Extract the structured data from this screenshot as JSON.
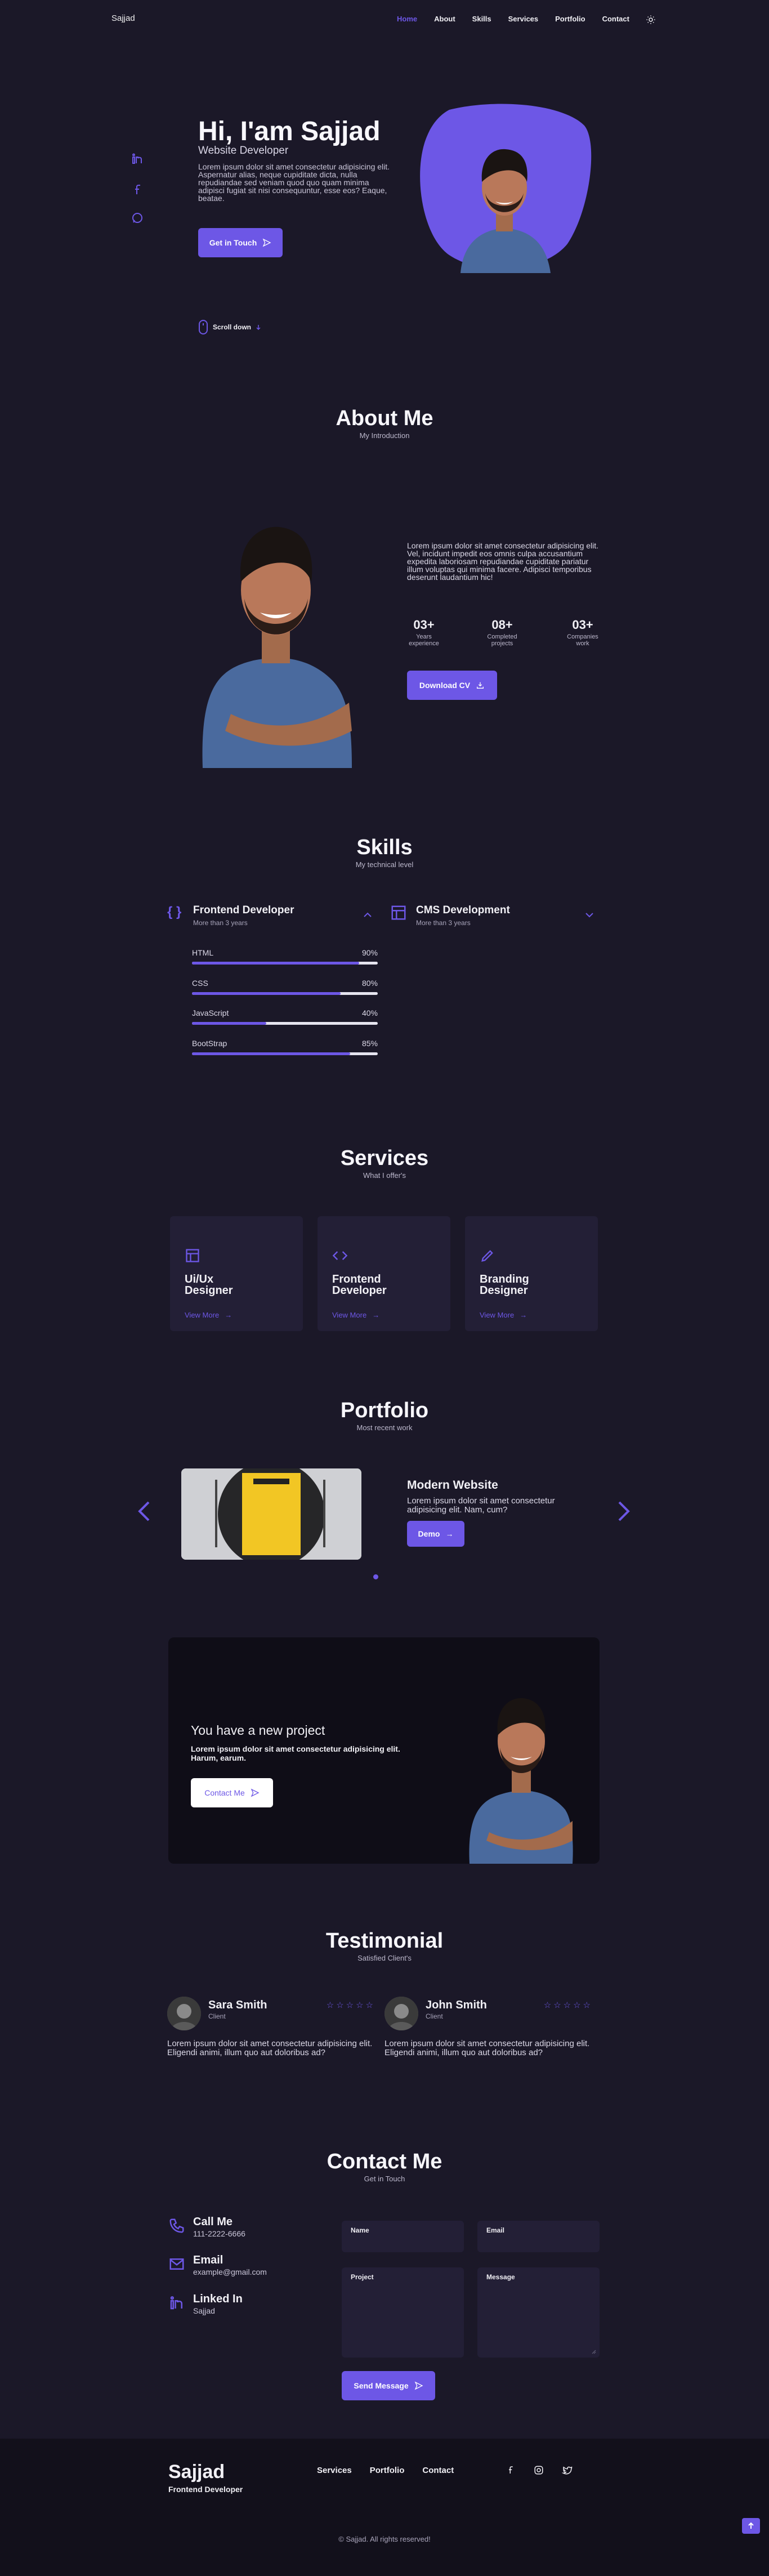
{
  "header": {
    "logo": "Sajjad",
    "nav": [
      "Home",
      "About",
      "Skills",
      "Services",
      "Portfolio",
      "Contact"
    ],
    "active_nav": "Home",
    "theme_icon": "sun-icon"
  },
  "social": [
    "linkedin-icon",
    "facebook-icon",
    "whatsapp-icon"
  ],
  "hero": {
    "title": "Hi, I'am Sajjad",
    "subtitle": "Website Developer",
    "description": "Lorem ipsum dolor sit amet consectetur adipisicing elit. Aspernatur alias, neque cupiditate dicta, nulla repudiandae sed veniam quod quo quam minima adipisci fugiat sit nisi consequuntur, esse eos? Eaque, beatae.",
    "button": "Get in Touch",
    "scroll": "Scroll down"
  },
  "about": {
    "title": "About Me",
    "subtitle": "My Introduction",
    "description": "Lorem ipsum dolor sit amet consectetur adipisicing elit. Vel, incidunt impedit eos omnis culpa accusantium expedita laboriosam repudiandae cupiditate pariatur illum voluptas qui minima facere. Adipisci temporibus deserunt laudantium hic!",
    "stats": [
      {
        "number": "03+",
        "label1": "Years",
        "label2": "experience"
      },
      {
        "number": "08+",
        "label1": "Completed",
        "label2": "projects"
      },
      {
        "number": "03+",
        "label1": "Companies",
        "label2": "work"
      }
    ],
    "button": "Download CV"
  },
  "skills": {
    "title": "Skills",
    "subtitle": "My technical level",
    "groups": [
      {
        "title": "Frontend Developer",
        "sub": "More than 3 years"
      },
      {
        "title": "CMS Development",
        "sub": "More than 3 years"
      }
    ],
    "bars": [
      {
        "name": "HTML",
        "pct": "90%",
        "value": 0.9
      },
      {
        "name": "CSS",
        "pct": "80%",
        "value": 0.8
      },
      {
        "name": "JavaScript",
        "pct": "40%",
        "value": 0.4
      },
      {
        "name": "BootStrap",
        "pct": "85%",
        "value": 0.85
      }
    ]
  },
  "services": {
    "title": "Services",
    "subtitle": "What I offer's",
    "cards": [
      {
        "line1": "Ui/Ux",
        "line2": "Designer",
        "icon": "layout-icon",
        "more": "View More"
      },
      {
        "line1": "Frontend",
        "line2": "Developer",
        "icon": "code-icon",
        "more": "View More"
      },
      {
        "line1": "Branding",
        "line2": "Designer",
        "icon": "pencil-icon",
        "more": "View More"
      }
    ]
  },
  "portfolio": {
    "title": "Portfolio",
    "subtitle": "Most recent work",
    "item_title": "Modern Website",
    "item_desc": "Lorem ipsum dolor sit amet consectetur adipisicing elit. Nam, cum?",
    "button": "Demo"
  },
  "project": {
    "title": "You have a new project",
    "desc": "Lorem ipsum dolor sit amet consectetur adipisicing elit. Harum, earum.",
    "button": "Contact Me"
  },
  "testimonial": {
    "title": "Testimonial",
    "subtitle": "Satisfied Client's",
    "items": [
      {
        "name": "Sara Smith",
        "role": "Client",
        "stars": "☆☆☆☆☆",
        "text": "Lorem ipsum dolor sit amet consectetur adipisicing elit. Eligendi animi, illum quo aut doloribus ad?"
      },
      {
        "name": "John Smith",
        "role": "Client",
        "stars": "☆☆☆☆☆",
        "text": "Lorem ipsum dolor sit amet consectetur adipisicing elit. Eligendi animi, illum quo aut doloribus ad?"
      }
    ]
  },
  "contact": {
    "title": "Contact Me",
    "subtitle": "Get in Touch",
    "info": [
      {
        "title": "Call Me",
        "value": "111-2222-6666",
        "icon": "phone-icon"
      },
      {
        "title": "Email",
        "value": "example@gmail.com",
        "icon": "mail-icon"
      },
      {
        "title": "Linked In",
        "value": "Sajjad",
        "icon": "linkedin-icon"
      }
    ],
    "fields": {
      "name": "Name",
      "email": "Email",
      "project": "Project",
      "message": "Message"
    },
    "button": "Send Message"
  },
  "footer": {
    "name": "Sajjad",
    "role": "Frontend Developer",
    "links": [
      "Services",
      "Portfolio",
      "Contact"
    ],
    "copyright": "© Sajjad. All rights reserved!"
  }
}
